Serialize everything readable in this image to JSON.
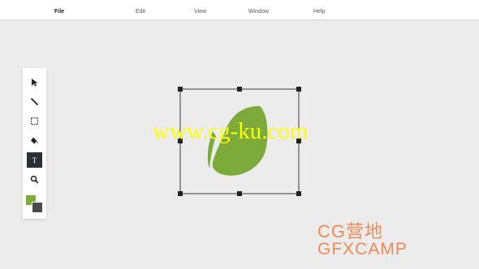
{
  "menu": {
    "file": "File",
    "edit": "Edit",
    "view": "View",
    "window": "Window",
    "help": "Help",
    "active": "File"
  },
  "tools": [
    {
      "icon": "arrow-pointer-icon"
    },
    {
      "icon": "line-tool-icon"
    },
    {
      "icon": "marquee-select-icon"
    },
    {
      "icon": "paint-bucket-icon"
    },
    {
      "icon": "text-tool-icon",
      "selected": true,
      "glyph": "T"
    },
    {
      "icon": "zoom-icon"
    }
  ],
  "colors": {
    "fill": "#7cab3b",
    "stroke": "#4a4a4a",
    "selected_tool_bg": "#2b2f36"
  },
  "watermark": {
    "text": "www.cg-ku.com",
    "color": "#ffff00"
  },
  "logo": {
    "line1": "CG营地",
    "line2": "GFXCAMP",
    "color": "#f08a55"
  }
}
